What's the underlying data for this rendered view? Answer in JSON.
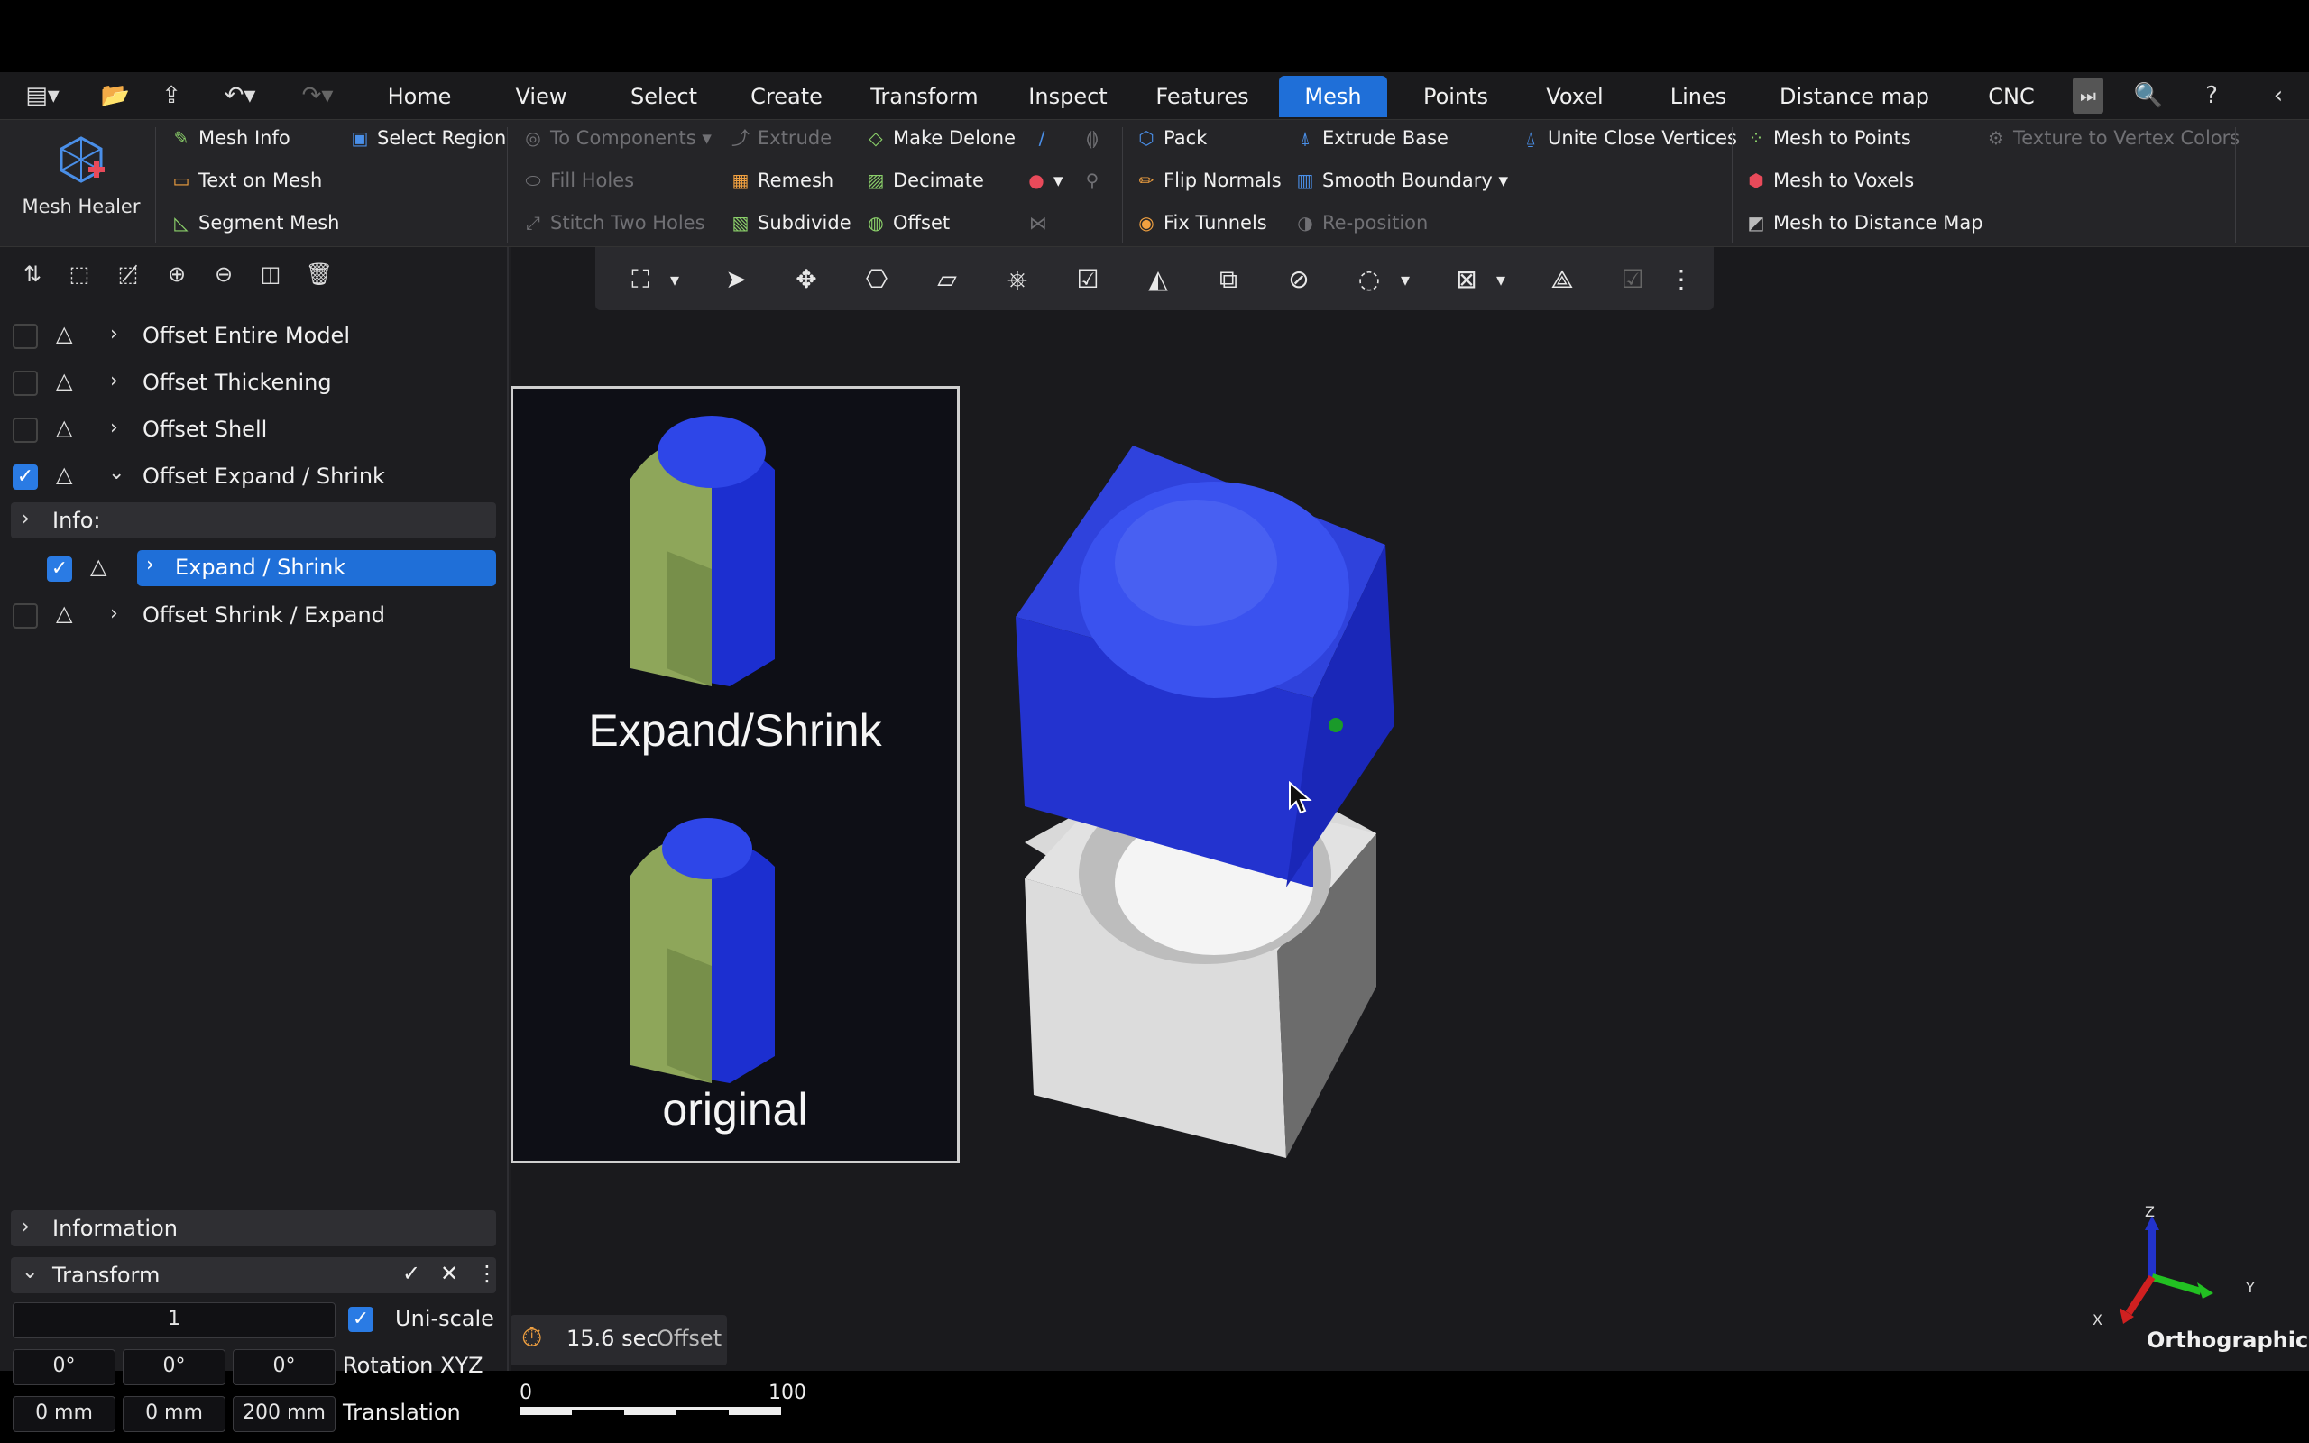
{
  "tabs": [
    "Home",
    "View",
    "Select",
    "Create",
    "Transform",
    "Inspect",
    "Features",
    "Mesh",
    "Points",
    "Voxel",
    "Lines",
    "Distance map",
    "CNC"
  ],
  "active_tab": "Mesh",
  "ribbon": {
    "mesh_healer": "Mesh Healer",
    "mesh_info": "Mesh Info",
    "select_region": "Select Region",
    "text_on_mesh": "Text on Mesh",
    "segment_mesh": "Segment Mesh",
    "to_components": "To Components",
    "fill_holes": "Fill Holes",
    "stitch_two_holes": "Stitch Two Holes",
    "extrude": "Extrude",
    "remesh": "Remesh",
    "subdivide": "Subdivide",
    "make_delone": "Make Delone",
    "decimate": "Decimate",
    "offset": "Offset",
    "pack": "Pack",
    "flip_normals": "Flip Normals",
    "fix_tunnels": "Fix Tunnels",
    "extrude_base": "Extrude Base",
    "smooth_boundary": "Smooth Boundary",
    "reposition": "Re-position",
    "unite_close_vertices": "Unite Close Vertices",
    "mesh_to_points": "Mesh to Points",
    "mesh_to_voxels": "Mesh to Voxels",
    "mesh_to_distance_map": "Mesh to Distance Map",
    "texture_to_vertex_colors": "Texture to Vertex Colors"
  },
  "scene_tree": [
    {
      "label": "Offset Entire Model",
      "checked": false
    },
    {
      "label": "Offset Thickening",
      "checked": false
    },
    {
      "label": "Offset Shell",
      "checked": false
    },
    {
      "label": "Offset Expand / Shrink",
      "checked": true
    },
    {
      "label": "Info:"
    },
    {
      "label": "Expand / Shrink",
      "checked": true,
      "selected": true
    },
    {
      "label": "Offset Shrink / Expand",
      "checked": false
    }
  ],
  "panels": {
    "information": "Information",
    "transform": "Transform",
    "uniscale_value": "1",
    "uniscale_label": "Uni-scale",
    "rotation": [
      "0°",
      "0°",
      "0°"
    ],
    "rotation_label": "Rotation XYZ",
    "translation": [
      "0 mm",
      "0 mm",
      "200 mm"
    ],
    "translation_label": "Translation"
  },
  "viewport": {
    "image_caption_top": "Expand/Shrink",
    "image_caption_bottom": "original",
    "timer_value": "15.6 sec",
    "timer_label": "Offset",
    "scale_start": "0",
    "scale_end": "100",
    "axis_x": "X",
    "axis_y": "Y",
    "axis_z": "Z",
    "projection": "Orthographic"
  },
  "colors": {
    "accent": "#2a7be4",
    "mesh_blue": "#2d3fd8",
    "mesh_white": "#e8e8e8",
    "panel_bg": "#1f1f22"
  }
}
